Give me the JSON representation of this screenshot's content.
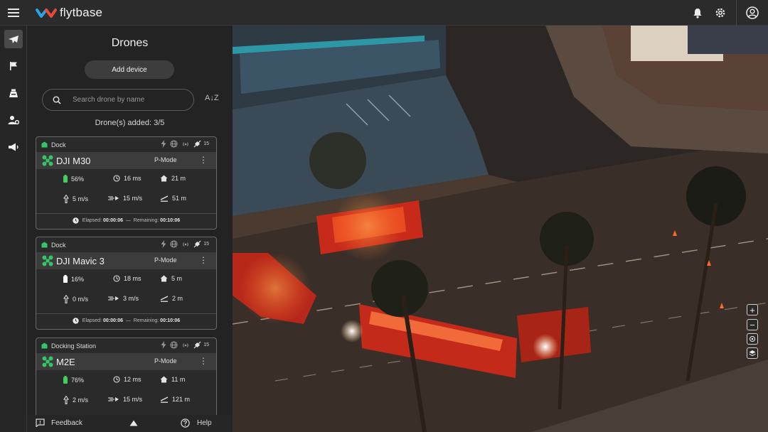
{
  "app": {
    "brand": "flytbase"
  },
  "panel": {
    "title": "Drones",
    "add_device": "Add device",
    "search_placeholder": "Search drone by name",
    "sort_label": "A↓Z",
    "count_text": "Drone(s) added: 3/5"
  },
  "drones": [
    {
      "dock": "Dock",
      "sat_count": "15",
      "name": "DJI M30",
      "mode": "P-Mode",
      "battery": "56%",
      "latency": "16 ms",
      "home_dist": "21 m",
      "v_speed": "5 m/s",
      "h_speed": "15 m/s",
      "altitude": "51 m",
      "elapsed_label": "Elapsed:",
      "elapsed": "00:00:06",
      "sep": "—",
      "remaining_label": "Remaining:",
      "remaining": "00:10:06",
      "battery_color": "#3fcf5a"
    },
    {
      "dock": "Dock",
      "sat_count": "15",
      "name": "DJI Mavic 3",
      "mode": "P-Mode",
      "battery": "16%",
      "latency": "18 ms",
      "home_dist": "5 m",
      "v_speed": "0 m/s",
      "h_speed": "3 m/s",
      "altitude": "2 m",
      "elapsed_label": "Elapsed:",
      "elapsed": "00:00:06",
      "sep": "—",
      "remaining_label": "Remaining:",
      "remaining": "00:10:06",
      "battery_color": "#ffffff"
    },
    {
      "dock": "Docking Station",
      "sat_count": "15",
      "name": "M2E",
      "mode": "P-Mode",
      "battery": "76%",
      "latency": "12 ms",
      "home_dist": "11 m",
      "v_speed": "2 m/s",
      "h_speed": "15 m/s",
      "altitude": "121 m",
      "battery_color": "#3fcf5a"
    }
  ],
  "footer": {
    "feedback": "Feedback",
    "help": "Help"
  },
  "map": {
    "controls": [
      "+",
      "−"
    ]
  },
  "colors": {
    "accent_green": "#35c46a",
    "brand_blue": "#2aa3e8",
    "brand_red": "#e84a3a"
  }
}
